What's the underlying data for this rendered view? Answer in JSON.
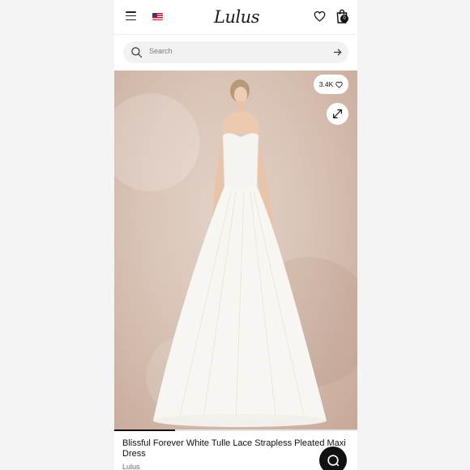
{
  "header": {
    "logo_text": "Lulus",
    "menu_icon": "hamburger-menu-icon",
    "flag_icon": "us-flag-icon",
    "wishlist_icon": "heart-icon",
    "bag_icon": "shopping-bag-icon",
    "bag_count": "0"
  },
  "search": {
    "placeholder": "Search",
    "icon": "search-icon",
    "submit_icon": "arrow-right-icon"
  },
  "product": {
    "likes": "3.4K",
    "like_icon": "heart-icon",
    "expand_icon": "expand-arrows-icon",
    "carousel_progress": 0.25,
    "title": "Blissful Forever White Tulle Lace Strapless Pleated Maxi Dress",
    "brand": "Lulus"
  },
  "chat": {
    "icon": "chat-bubble-icon"
  },
  "colors": {
    "background": "#ffffff",
    "accent": "#111111",
    "photo_backdrop": "#d9c3b6"
  }
}
